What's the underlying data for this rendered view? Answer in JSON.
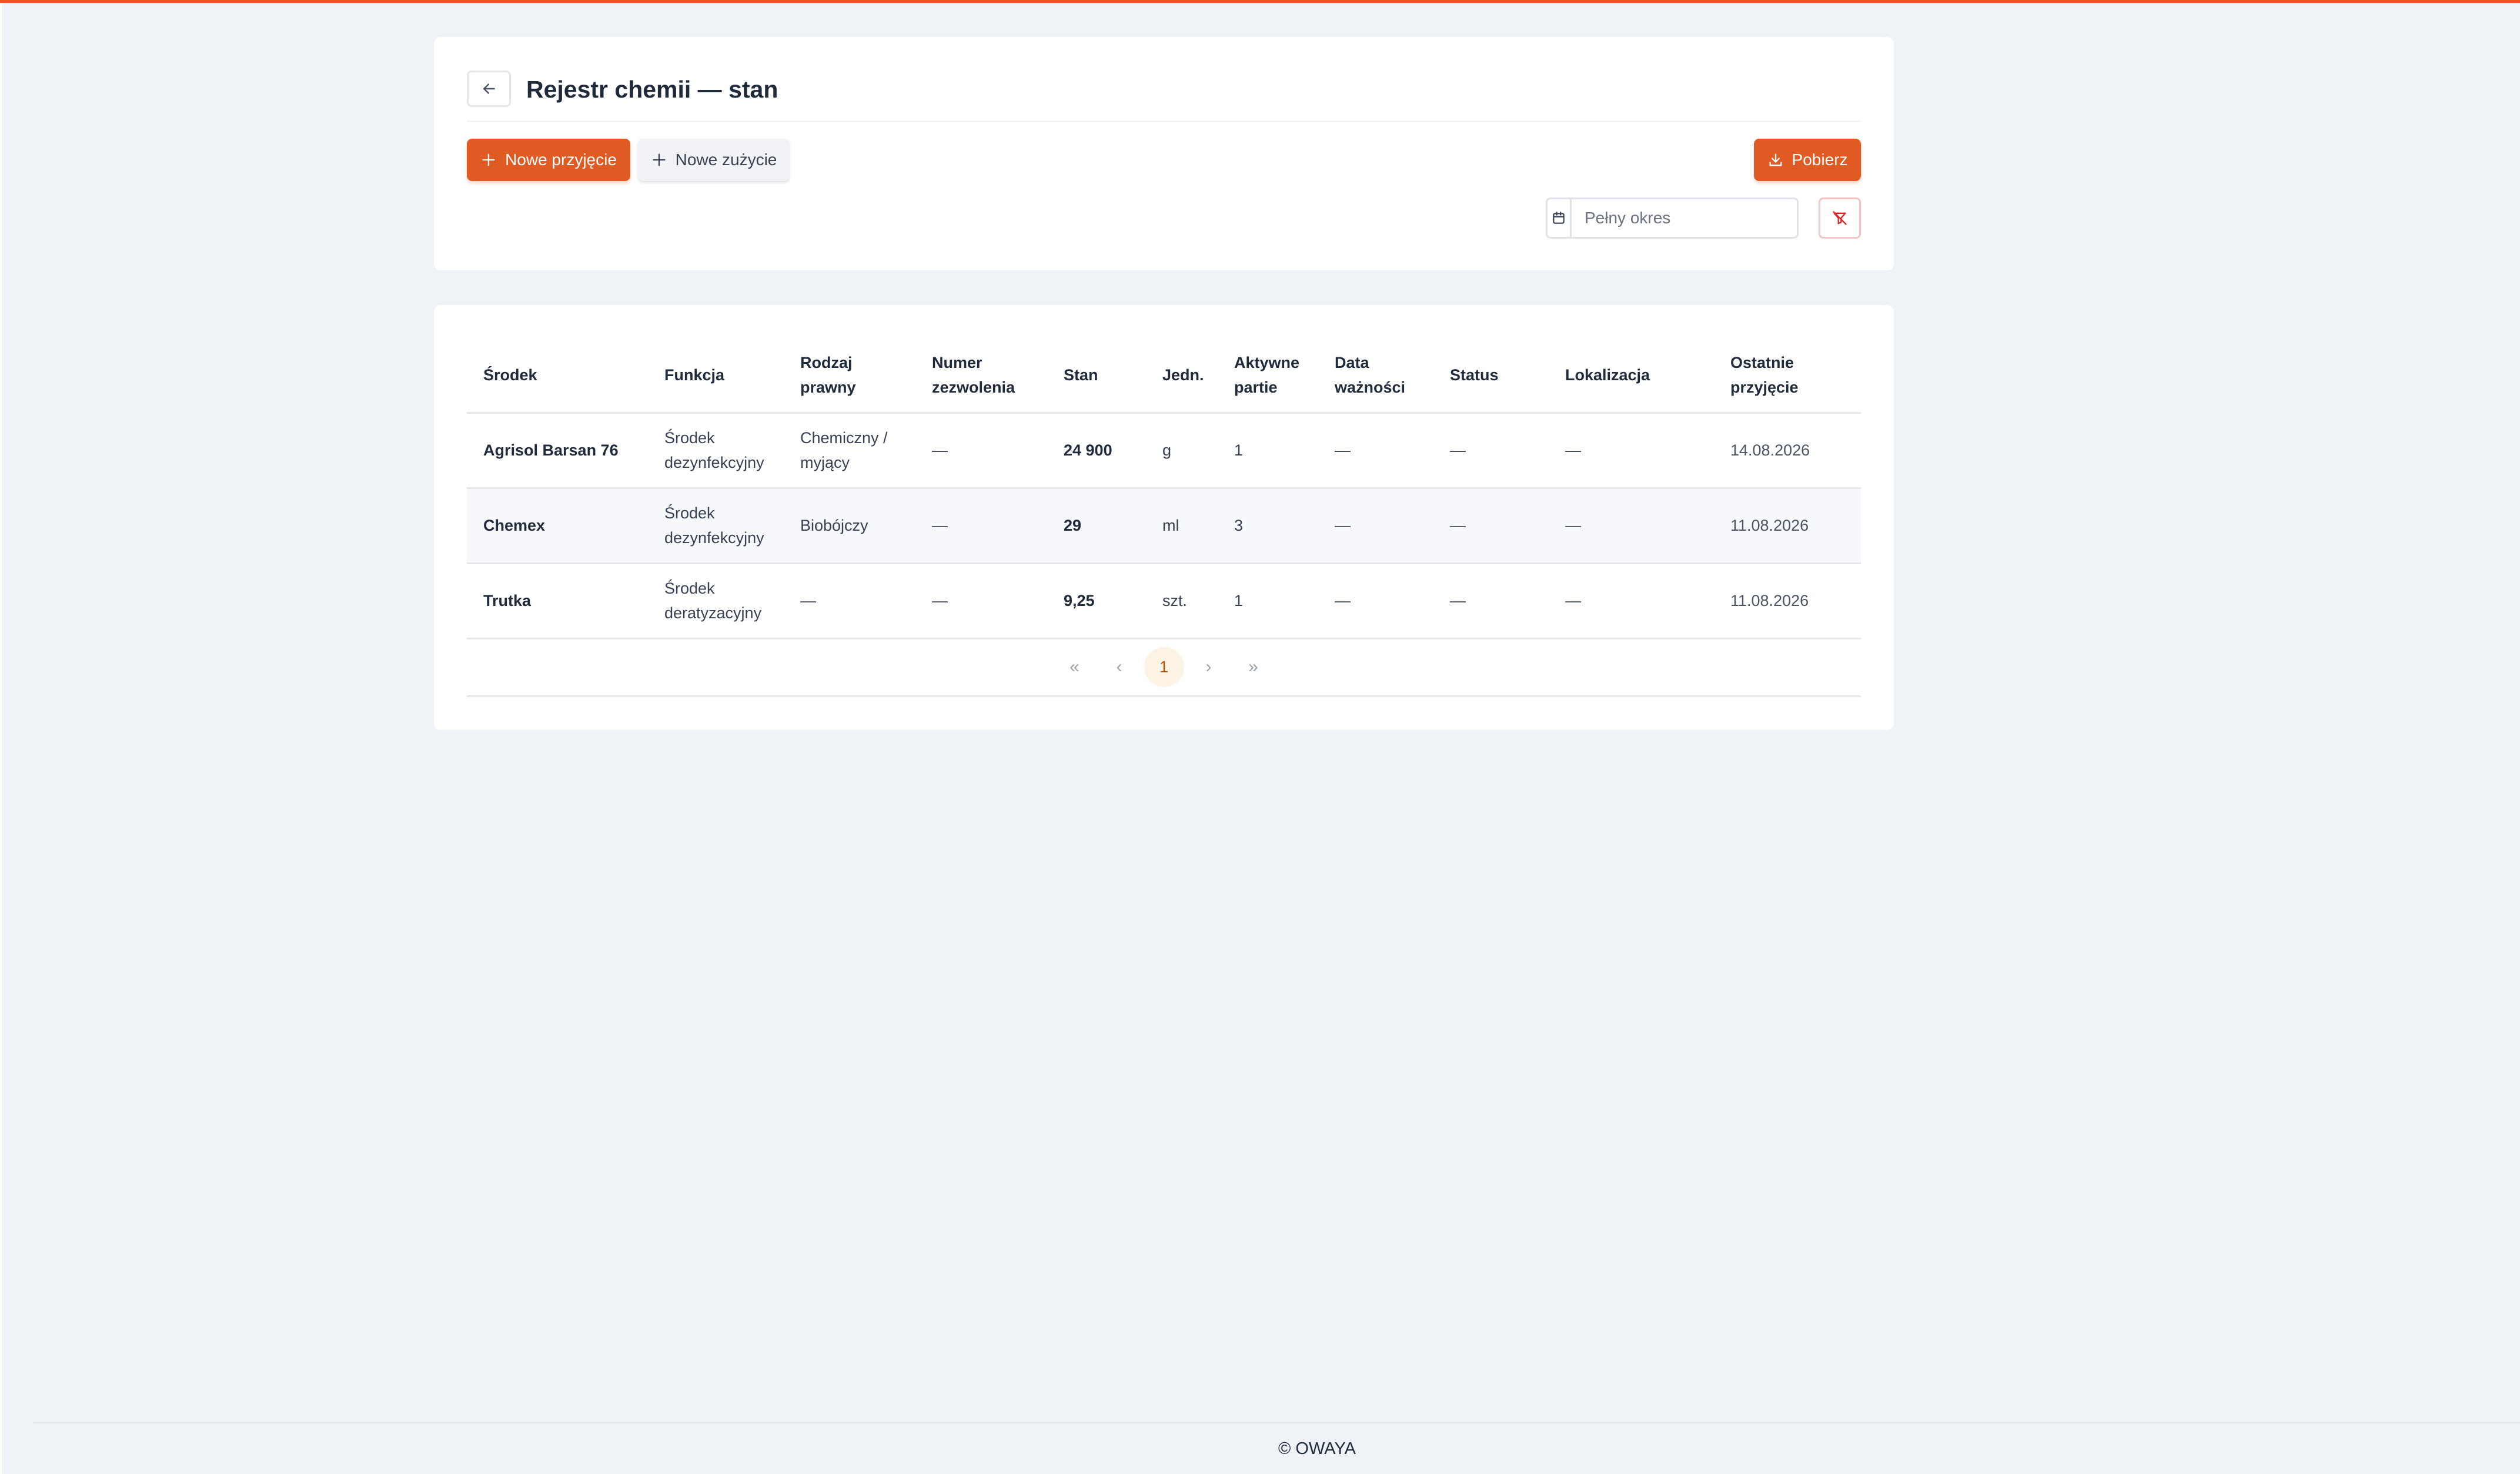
{
  "page": {
    "title": "Rejestr chemii — stan",
    "accent_color": "#e05a24"
  },
  "toolbar": {
    "back_icon": "arrow-left-icon",
    "new_intake_label": "Nowe przyjęcie",
    "new_usage_label": "Nowe zużycie",
    "download_label": "Pobierz",
    "date_range_placeholder": "Pełny okres",
    "calendar_icon": "calendar-icon",
    "clear_filter_icon": "filter-clear-icon"
  },
  "table": {
    "columns": [
      [
        "Środek"
      ],
      [
        "Funkcja"
      ],
      [
        "Rodzaj",
        "prawny"
      ],
      [
        "Numer",
        "zezwolenia"
      ],
      [
        "Stan"
      ],
      [
        "Jedn."
      ],
      [
        "Aktywne",
        "partie"
      ],
      [
        "Data",
        "ważności"
      ],
      [
        "Status"
      ],
      [
        "Lokalizacja"
      ],
      [
        "Ostatnie",
        "przyjęcie"
      ]
    ],
    "rows": [
      {
        "name": "Agrisol Barsan 76",
        "function": [
          "Środek",
          "dezynfekcyjny"
        ],
        "legal_type": [
          "Chemiczny /",
          "myjący"
        ],
        "permit": "—",
        "stock": "24 900",
        "unit": "g",
        "active_batches": "1",
        "expiry": "—",
        "status": "—",
        "location": "—",
        "last_intake": "14.08.2026"
      },
      {
        "name": "Chemex",
        "function": [
          "Środek",
          "dezynfekcyjny"
        ],
        "legal_type": [
          "Biobójczy"
        ],
        "permit": "—",
        "stock": "29",
        "unit": "ml",
        "active_batches": "3",
        "expiry": "—",
        "status": "—",
        "location": "—",
        "last_intake": "11.08.2026"
      },
      {
        "name": "Trutka",
        "function": [
          "Środek",
          "deratyzacyjny"
        ],
        "legal_type": [
          "—"
        ],
        "permit": "—",
        "stock": "9,25",
        "unit": "szt.",
        "active_batches": "1",
        "expiry": "—",
        "status": "—",
        "location": "—",
        "last_intake": "11.08.2026"
      }
    ]
  },
  "pagination": {
    "first_label": "«",
    "prev_label": "‹",
    "current_page": "1",
    "next_label": "›",
    "last_label": "»"
  },
  "footer": {
    "text": "© OWAYA"
  }
}
